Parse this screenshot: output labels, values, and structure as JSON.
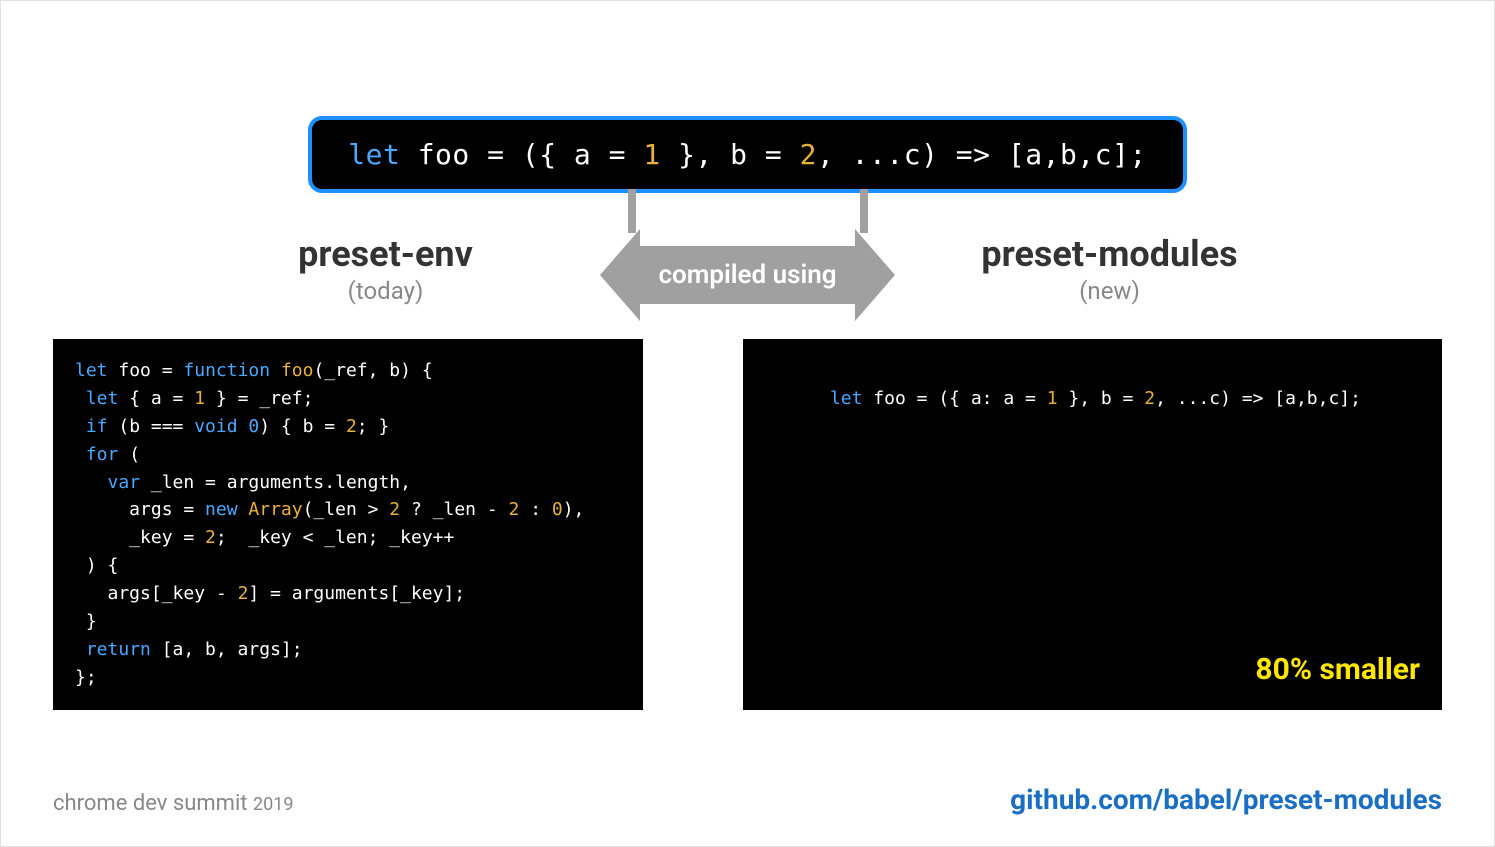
{
  "source_code": {
    "text": "let foo = ({ a = 1 }, b = 2, ...c) => [a,b,c];",
    "tokens": [
      {
        "t": "let ",
        "c": "tok-kw"
      },
      {
        "t": "foo = ({ a = "
      },
      {
        "t": "1",
        "c": "tok-num"
      },
      {
        "t": " }, b = "
      },
      {
        "t": "2",
        "c": "tok-num"
      },
      {
        "t": ", ...c) => [a,b,c];"
      }
    ]
  },
  "compiled_label": "compiled using",
  "left": {
    "title": "preset-env",
    "subtitle": "(today)",
    "code_tokens": [
      {
        "t": "let ",
        "c": "tok-kw"
      },
      {
        "t": "foo = "
      },
      {
        "t": "function ",
        "c": "tok-kw"
      },
      {
        "t": "foo",
        "c": "tok-fn"
      },
      {
        "t": "(_ref, b) {\n "
      },
      {
        "t": "let ",
        "c": "tok-kw"
      },
      {
        "t": "{ a = "
      },
      {
        "t": "1",
        "c": "tok-num"
      },
      {
        "t": " } = _ref;\n "
      },
      {
        "t": "if ",
        "c": "tok-kw"
      },
      {
        "t": "(b === "
      },
      {
        "t": "void 0",
        "c": "tok-kw"
      },
      {
        "t": ") { b = "
      },
      {
        "t": "2",
        "c": "tok-num"
      },
      {
        "t": "; }\n "
      },
      {
        "t": "for ",
        "c": "tok-kw"
      },
      {
        "t": "(\n   "
      },
      {
        "t": "var ",
        "c": "tok-kw"
      },
      {
        "t": "_len = arguments.length,\n     args = "
      },
      {
        "t": "new ",
        "c": "tok-kw"
      },
      {
        "t": "Array",
        "c": "tok-fn"
      },
      {
        "t": "(_len > "
      },
      {
        "t": "2",
        "c": "tok-num"
      },
      {
        "t": " ? _len - "
      },
      {
        "t": "2",
        "c": "tok-num"
      },
      {
        "t": " : "
      },
      {
        "t": "0",
        "c": "tok-num"
      },
      {
        "t": "),\n     _key = "
      },
      {
        "t": "2",
        "c": "tok-num"
      },
      {
        "t": ";  _key < _len; _key++\n ) {\n   args[_key - "
      },
      {
        "t": "2",
        "c": "tok-num"
      },
      {
        "t": "] = arguments[_key];\n }\n "
      },
      {
        "t": "return ",
        "c": "tok-ret"
      },
      {
        "t": "[a, b, args];\n};"
      }
    ]
  },
  "right": {
    "title": "preset-modules",
    "subtitle": "(new)",
    "badge": "80% smaller",
    "code_tokens": [
      {
        "t": "let ",
        "c": "tok-kw"
      },
      {
        "t": "foo = ({ a: a = "
      },
      {
        "t": "1",
        "c": "tok-num"
      },
      {
        "t": " }, b = "
      },
      {
        "t": "2",
        "c": "tok-num"
      },
      {
        "t": ", ...c) => [a,b,c];"
      }
    ]
  },
  "footer": {
    "event": "chrome dev summit",
    "year": "2019",
    "link": "github.com/babel/preset-modules"
  }
}
